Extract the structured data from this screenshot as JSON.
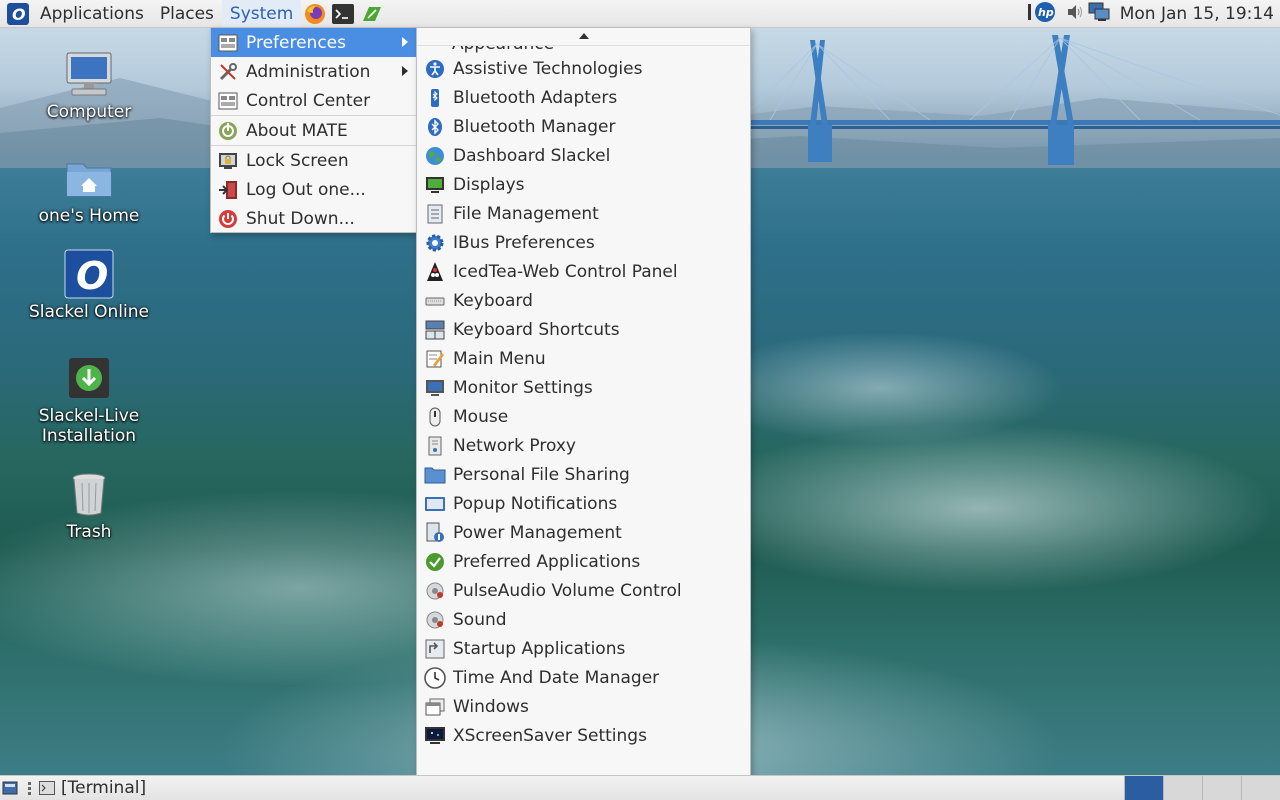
{
  "top_panel": {
    "menus": {
      "applications": "Applications",
      "places": "Places",
      "system": "System"
    },
    "clock": "Mon Jan 15, 19:14",
    "launchers": [
      "firefox-icon",
      "terminal-icon",
      "slackel-icon"
    ],
    "tray_icons": [
      "hp-icon",
      "volume-icon",
      "network-icon"
    ]
  },
  "desktop": {
    "icons": [
      {
        "label": "Computer",
        "icon": "computer-icon"
      },
      {
        "label": "one's Home",
        "icon": "home-folder-icon"
      },
      {
        "label": "Slackel Online",
        "icon": "slackel-online-icon"
      },
      {
        "label": "Slackel-Live Installation",
        "icon": "installer-icon"
      },
      {
        "label": "Trash",
        "icon": "trash-icon"
      }
    ]
  },
  "system_menu": {
    "items": [
      {
        "label": "Preferences",
        "icon": "preferences-icon",
        "submenu": true
      },
      {
        "label": "Administration",
        "icon": "administration-icon",
        "submenu": true
      },
      {
        "label": "Control Center",
        "icon": "control-center-icon"
      },
      {
        "label": "About MATE",
        "icon": "mate-icon"
      },
      {
        "label": "Lock Screen",
        "icon": "lock-screen-icon"
      },
      {
        "label": "Log Out one...",
        "icon": "log-out-icon"
      },
      {
        "label": "Shut Down...",
        "icon": "shut-down-icon"
      }
    ]
  },
  "preferences_menu": {
    "cut_off_item": "Appearance",
    "items": [
      {
        "label": "Assistive Technologies",
        "icon": "accessibility-icon"
      },
      {
        "label": "Bluetooth Adapters",
        "icon": "bluetooth-adapter-icon"
      },
      {
        "label": "Bluetooth Manager",
        "icon": "bluetooth-icon"
      },
      {
        "label": "Dashboard Slackel",
        "icon": "globe-icon"
      },
      {
        "label": "Displays",
        "icon": "display-icon"
      },
      {
        "label": "File Management",
        "icon": "file-management-icon"
      },
      {
        "label": "IBus Preferences",
        "icon": "gear-icon"
      },
      {
        "label": "IcedTea-Web Control Panel",
        "icon": "icedtea-icon"
      },
      {
        "label": "Keyboard",
        "icon": "keyboard-icon"
      },
      {
        "label": "Keyboard Shortcuts",
        "icon": "keyboard-shortcuts-icon"
      },
      {
        "label": "Main Menu",
        "icon": "main-menu-icon"
      },
      {
        "label": "Monitor Settings",
        "icon": "monitor-icon"
      },
      {
        "label": "Mouse",
        "icon": "mouse-icon"
      },
      {
        "label": "Network Proxy",
        "icon": "network-proxy-icon"
      },
      {
        "label": "Personal File Sharing",
        "icon": "file-sharing-icon"
      },
      {
        "label": "Popup Notifications",
        "icon": "notification-icon"
      },
      {
        "label": "Power Management",
        "icon": "power-management-icon"
      },
      {
        "label": "Preferred Applications",
        "icon": "preferred-apps-icon"
      },
      {
        "label": "PulseAudio Volume Control",
        "icon": "pulseaudio-icon"
      },
      {
        "label": "Sound",
        "icon": "sound-icon"
      },
      {
        "label": "Startup Applications",
        "icon": "startup-icon"
      },
      {
        "label": "Time And Date Manager",
        "icon": "clock-icon"
      },
      {
        "label": "Windows",
        "icon": "windows-icon"
      },
      {
        "label": "XScreenSaver Settings",
        "icon": "screensaver-icon"
      }
    ]
  },
  "bottom_panel": {
    "task": "[Terminal]",
    "workspace_count": 4,
    "active_workspace": 1
  },
  "colors": {
    "highlight": "#4a8ee3",
    "panel_active_text": "#2a62b5",
    "active_workspace": "#2b5da3"
  }
}
